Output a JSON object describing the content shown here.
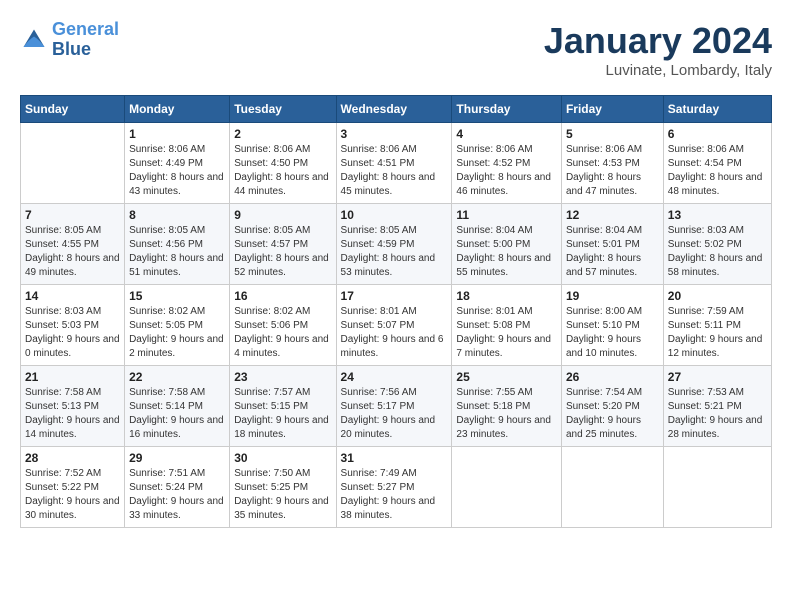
{
  "header": {
    "logo_line1": "General",
    "logo_line2": "Blue",
    "month_title": "January 2024",
    "location": "Luvinate, Lombardy, Italy"
  },
  "weekdays": [
    "Sunday",
    "Monday",
    "Tuesday",
    "Wednesday",
    "Thursday",
    "Friday",
    "Saturday"
  ],
  "weeks": [
    [
      {
        "day": "",
        "sunrise": "",
        "sunset": "",
        "daylight": ""
      },
      {
        "day": "1",
        "sunrise": "Sunrise: 8:06 AM",
        "sunset": "Sunset: 4:49 PM",
        "daylight": "Daylight: 8 hours and 43 minutes."
      },
      {
        "day": "2",
        "sunrise": "Sunrise: 8:06 AM",
        "sunset": "Sunset: 4:50 PM",
        "daylight": "Daylight: 8 hours and 44 minutes."
      },
      {
        "day": "3",
        "sunrise": "Sunrise: 8:06 AM",
        "sunset": "Sunset: 4:51 PM",
        "daylight": "Daylight: 8 hours and 45 minutes."
      },
      {
        "day": "4",
        "sunrise": "Sunrise: 8:06 AM",
        "sunset": "Sunset: 4:52 PM",
        "daylight": "Daylight: 8 hours and 46 minutes."
      },
      {
        "day": "5",
        "sunrise": "Sunrise: 8:06 AM",
        "sunset": "Sunset: 4:53 PM",
        "daylight": "Daylight: 8 hours and 47 minutes."
      },
      {
        "day": "6",
        "sunrise": "Sunrise: 8:06 AM",
        "sunset": "Sunset: 4:54 PM",
        "daylight": "Daylight: 8 hours and 48 minutes."
      }
    ],
    [
      {
        "day": "7",
        "sunrise": "Sunrise: 8:05 AM",
        "sunset": "Sunset: 4:55 PM",
        "daylight": "Daylight: 8 hours and 49 minutes."
      },
      {
        "day": "8",
        "sunrise": "Sunrise: 8:05 AM",
        "sunset": "Sunset: 4:56 PM",
        "daylight": "Daylight: 8 hours and 51 minutes."
      },
      {
        "day": "9",
        "sunrise": "Sunrise: 8:05 AM",
        "sunset": "Sunset: 4:57 PM",
        "daylight": "Daylight: 8 hours and 52 minutes."
      },
      {
        "day": "10",
        "sunrise": "Sunrise: 8:05 AM",
        "sunset": "Sunset: 4:59 PM",
        "daylight": "Daylight: 8 hours and 53 minutes."
      },
      {
        "day": "11",
        "sunrise": "Sunrise: 8:04 AM",
        "sunset": "Sunset: 5:00 PM",
        "daylight": "Daylight: 8 hours and 55 minutes."
      },
      {
        "day": "12",
        "sunrise": "Sunrise: 8:04 AM",
        "sunset": "Sunset: 5:01 PM",
        "daylight": "Daylight: 8 hours and 57 minutes."
      },
      {
        "day": "13",
        "sunrise": "Sunrise: 8:03 AM",
        "sunset": "Sunset: 5:02 PM",
        "daylight": "Daylight: 8 hours and 58 minutes."
      }
    ],
    [
      {
        "day": "14",
        "sunrise": "Sunrise: 8:03 AM",
        "sunset": "Sunset: 5:03 PM",
        "daylight": "Daylight: 9 hours and 0 minutes."
      },
      {
        "day": "15",
        "sunrise": "Sunrise: 8:02 AM",
        "sunset": "Sunset: 5:05 PM",
        "daylight": "Daylight: 9 hours and 2 minutes."
      },
      {
        "day": "16",
        "sunrise": "Sunrise: 8:02 AM",
        "sunset": "Sunset: 5:06 PM",
        "daylight": "Daylight: 9 hours and 4 minutes."
      },
      {
        "day": "17",
        "sunrise": "Sunrise: 8:01 AM",
        "sunset": "Sunset: 5:07 PM",
        "daylight": "Daylight: 9 hours and 6 minutes."
      },
      {
        "day": "18",
        "sunrise": "Sunrise: 8:01 AM",
        "sunset": "Sunset: 5:08 PM",
        "daylight": "Daylight: 9 hours and 7 minutes."
      },
      {
        "day": "19",
        "sunrise": "Sunrise: 8:00 AM",
        "sunset": "Sunset: 5:10 PM",
        "daylight": "Daylight: 9 hours and 10 minutes."
      },
      {
        "day": "20",
        "sunrise": "Sunrise: 7:59 AM",
        "sunset": "Sunset: 5:11 PM",
        "daylight": "Daylight: 9 hours and 12 minutes."
      }
    ],
    [
      {
        "day": "21",
        "sunrise": "Sunrise: 7:58 AM",
        "sunset": "Sunset: 5:13 PM",
        "daylight": "Daylight: 9 hours and 14 minutes."
      },
      {
        "day": "22",
        "sunrise": "Sunrise: 7:58 AM",
        "sunset": "Sunset: 5:14 PM",
        "daylight": "Daylight: 9 hours and 16 minutes."
      },
      {
        "day": "23",
        "sunrise": "Sunrise: 7:57 AM",
        "sunset": "Sunset: 5:15 PM",
        "daylight": "Daylight: 9 hours and 18 minutes."
      },
      {
        "day": "24",
        "sunrise": "Sunrise: 7:56 AM",
        "sunset": "Sunset: 5:17 PM",
        "daylight": "Daylight: 9 hours and 20 minutes."
      },
      {
        "day": "25",
        "sunrise": "Sunrise: 7:55 AM",
        "sunset": "Sunset: 5:18 PM",
        "daylight": "Daylight: 9 hours and 23 minutes."
      },
      {
        "day": "26",
        "sunrise": "Sunrise: 7:54 AM",
        "sunset": "Sunset: 5:20 PM",
        "daylight": "Daylight: 9 hours and 25 minutes."
      },
      {
        "day": "27",
        "sunrise": "Sunrise: 7:53 AM",
        "sunset": "Sunset: 5:21 PM",
        "daylight": "Daylight: 9 hours and 28 minutes."
      }
    ],
    [
      {
        "day": "28",
        "sunrise": "Sunrise: 7:52 AM",
        "sunset": "Sunset: 5:22 PM",
        "daylight": "Daylight: 9 hours and 30 minutes."
      },
      {
        "day": "29",
        "sunrise": "Sunrise: 7:51 AM",
        "sunset": "Sunset: 5:24 PM",
        "daylight": "Daylight: 9 hours and 33 minutes."
      },
      {
        "day": "30",
        "sunrise": "Sunrise: 7:50 AM",
        "sunset": "Sunset: 5:25 PM",
        "daylight": "Daylight: 9 hours and 35 minutes."
      },
      {
        "day": "31",
        "sunrise": "Sunrise: 7:49 AM",
        "sunset": "Sunset: 5:27 PM",
        "daylight": "Daylight: 9 hours and 38 minutes."
      },
      {
        "day": "",
        "sunrise": "",
        "sunset": "",
        "daylight": ""
      },
      {
        "day": "",
        "sunrise": "",
        "sunset": "",
        "daylight": ""
      },
      {
        "day": "",
        "sunrise": "",
        "sunset": "",
        "daylight": ""
      }
    ]
  ]
}
